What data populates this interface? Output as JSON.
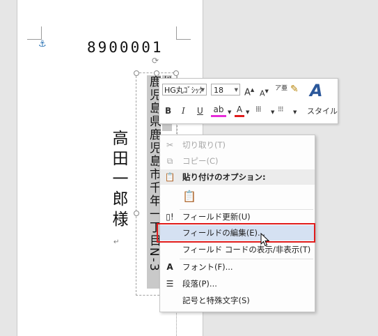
{
  "document": {
    "postal_code": "8900001",
    "recipient_name": "高田一郎様",
    "address_text": "鹿児島県鹿児島市千年一丁目N-3",
    "address_tail": "34"
  },
  "mini_toolbar": {
    "font_name": "HG丸ｺﾞｼｯｸ",
    "font_size": "18",
    "grow_font": "A",
    "shrink_font": "A",
    "bold": "B",
    "italic": "I",
    "underline": "U",
    "font_color": "A",
    "styles_label": "スタイル",
    "highlight_color": "#e62cd9",
    "font_color_value": "#e01b1b",
    "accent": "#2b579a"
  },
  "context_menu": {
    "items": [
      {
        "label": "切り取り(T)",
        "icon": "scissors-icon",
        "disabled": true
      },
      {
        "label": "コピー(C)",
        "icon": "copy-icon",
        "disabled": true
      },
      {
        "label": "貼り付けのオプション:",
        "icon": "paste-icon",
        "header": true
      },
      {
        "label": "フィールド更新(U)",
        "icon": "update-field-icon"
      },
      {
        "label": "フィールドの編集(E)...",
        "icon": "",
        "highlighted": true
      },
      {
        "label": "フィールド コードの表示/非表示(T)",
        "icon": ""
      },
      {
        "label": "フォント(F)...",
        "icon": "font-icon"
      },
      {
        "label": "段落(P)...",
        "icon": "paragraph-icon"
      },
      {
        "label": "記号と特殊文字(S)",
        "icon": ""
      }
    ]
  }
}
